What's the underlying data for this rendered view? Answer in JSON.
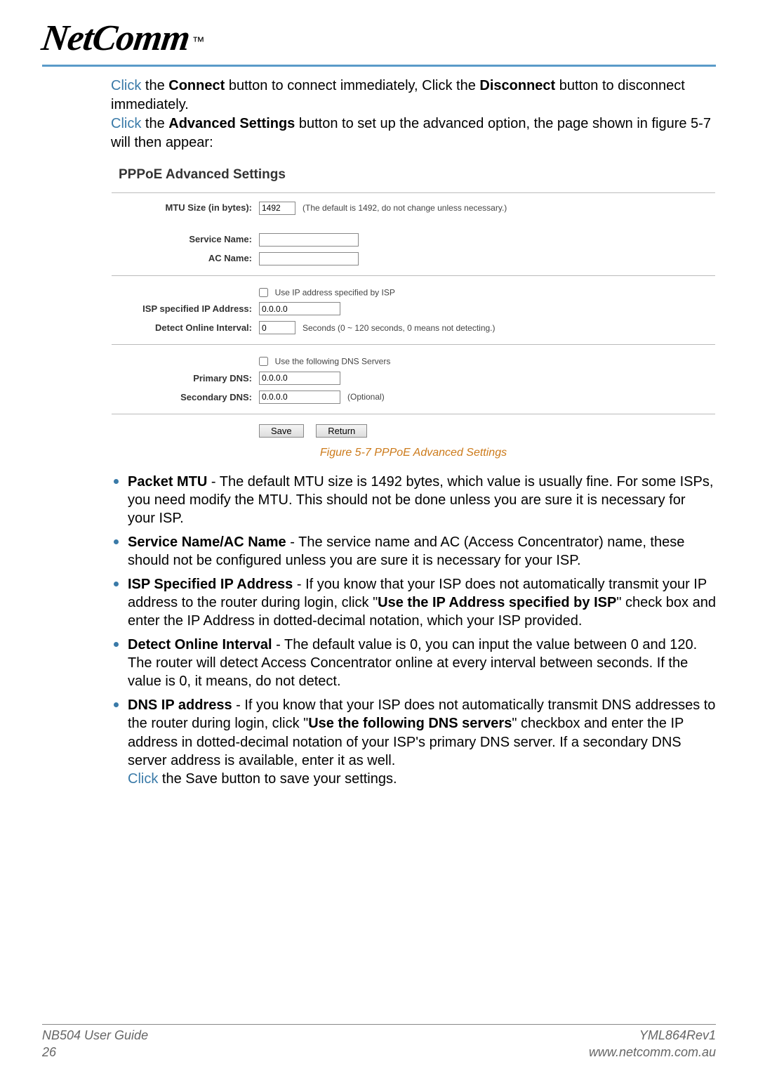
{
  "logo": {
    "text": "NetComm",
    "tm": "™"
  },
  "intro": {
    "p1_click": "Click",
    "p1_a": " the ",
    "p1_connect": "Connect",
    "p1_b": " button to connect immediately, Click the ",
    "p1_disconnect": "Disconnect",
    "p1_c": " button to disconnect immediately.",
    "p2_click": "Click",
    "p2_a": " the ",
    "p2_adv": "Advanced Settings",
    "p2_b": " button to set up the advanced option, the page shown in figure 5-7 will then appear:"
  },
  "panel": {
    "title": "PPPoE Advanced Settings",
    "mtu_label": "MTU Size (in bytes):",
    "mtu_value": "1492",
    "mtu_hint": "(The default is 1492, do not change unless necessary.)",
    "service_label": "Service Name:",
    "ac_label": "AC Name:",
    "use_ip_chk": "Use IP address specified by ISP",
    "isp_ip_label": "ISP specified IP Address:",
    "isp_ip_value": "0.0.0.0",
    "interval_label": "Detect Online Interval:",
    "interval_value": "0",
    "interval_hint": "Seconds (0 ~ 120 seconds, 0 means not detecting.)",
    "use_dns_chk": "Use the following DNS Servers",
    "primary_dns_label": "Primary DNS:",
    "primary_dns_value": "0.0.0.0",
    "secondary_dns_label": "Secondary DNS:",
    "secondary_dns_value": "0.0.0.0",
    "optional": "(Optional)",
    "save": "Save",
    "return": "Return"
  },
  "caption": "Figure 5-7 PPPoE Advanced Settings",
  "bullets": {
    "b1_t": "Packet MTU",
    "b1_b": " - The default MTU size is 1492 bytes, which value is usually fine. For some ISPs, you need modify the MTU. This should not be done unless you are sure it is necessary for your ISP.",
    "b2_t": "Service Name/AC Name",
    "b2_b": " - The service name and AC (Access Concentrator) name, these should not be configured unless you are sure it is necessary for your ISP.",
    "b3_t": "ISP Specified IP Address",
    "b3_a": " - If you know that your ISP does not automatically transmit your IP address to the router during login, click \"",
    "b3_m": "Use the IP Address specified by ISP",
    "b3_c": "\" check box and enter the IP Address in dotted-decimal notation, which your ISP provided.",
    "b4_t": "Detect Online Interval",
    "b4_b": " - The default value is 0, you can input the value between 0 and 120. The router will detect Access Concentrator online at every interval between seconds. If the value is 0, it means, do not detect.",
    "b5_t": "DNS IP address",
    "b5_a": " - If you know that your ISP does not automatically transmit DNS addresses to the router during login, click \"",
    "b5_m": "Use the following DNS servers",
    "b5_c": "\" checkbox and enter the IP address in dotted-decimal notation of your ISP's primary DNS server. If a secondary DNS server address is available, enter it as well.",
    "b5_click": "Click",
    "b5_save": " the Save button to save your settings."
  },
  "footer": {
    "left1": "NB504 User Guide",
    "left2": "26",
    "right1": "YML864Rev1",
    "right2": "www.netcomm.com.au"
  }
}
